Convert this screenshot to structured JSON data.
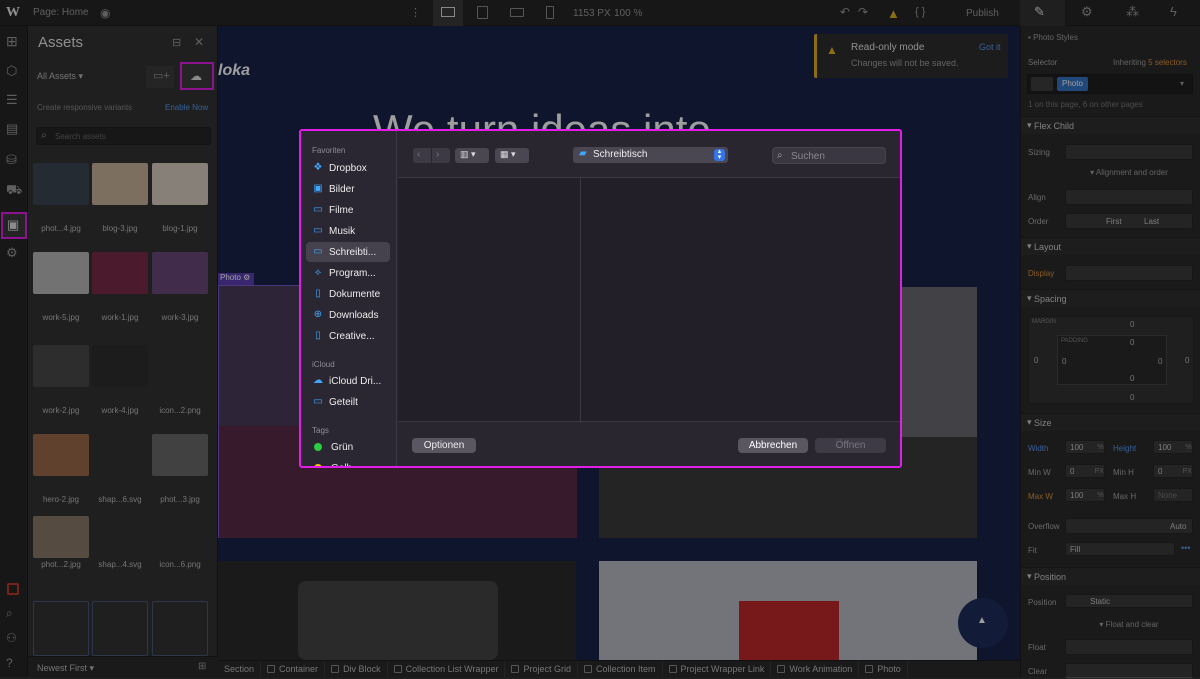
{
  "topbar": {
    "logo": "W",
    "page_label": "Page: Home",
    "width_readout": "1153 PX",
    "zoom_readout": "100 %",
    "publish_label": "Publish"
  },
  "banner": {
    "title": "Read-only mode",
    "subtitle": "Changes will not be saved.",
    "action": "Got it"
  },
  "assets": {
    "title": "Assets",
    "filter": "All Assets",
    "responsive_text": "Create responsive variants",
    "enable_now": "Enable Now",
    "search_placeholder": "Search assets",
    "sort": "Newest First",
    "items": [
      {
        "label": "phot...4.jpg",
        "color": "#3a4652"
      },
      {
        "label": "blog-3.jpg",
        "color": "#c9b39a"
      },
      {
        "label": "blog-1.jpg",
        "color": "#d8cfc2"
      },
      {
        "label": "work-5.jpg",
        "color": "#b8b8b8"
      },
      {
        "label": "work-1.jpg",
        "color": "#7a2a4a"
      },
      {
        "label": "work-3.jpg",
        "color": "#6a4a7a"
      },
      {
        "label": "work-2.jpg",
        "color": "#4a4a4a"
      },
      {
        "label": "work-4.jpg",
        "color": "#2e2e2e"
      },
      {
        "label": "icon...2.png",
        "color": "#333333"
      },
      {
        "label": "hero-2.jpg",
        "color": "#9a6a4a"
      },
      {
        "label": "shap...6.svg",
        "color": "#333333"
      },
      {
        "label": "phot...3.jpg",
        "color": "#6a6a6a"
      },
      {
        "label": "phot...2.jpg",
        "color": "#8a7a6a"
      },
      {
        "label": "shap...4.svg",
        "color": "#333333"
      },
      {
        "label": "icon...6.png",
        "color": "#333333"
      }
    ]
  },
  "canvas": {
    "logo_text": "loka",
    "hero_text": "We turn ideas into",
    "photo_tag": "Photo"
  },
  "dialog": {
    "location": "Schreibtisch",
    "search_placeholder": "Suchen",
    "favorites_header": "Favoriten",
    "favorites": [
      {
        "label": "Dropbox",
        "icon": "dropbox-icon"
      },
      {
        "label": "Bilder",
        "icon": "pictures-icon"
      },
      {
        "label": "Filme",
        "icon": "folder-icon"
      },
      {
        "label": "Musik",
        "icon": "folder-icon"
      },
      {
        "label": "Schreibti...",
        "icon": "folder-icon"
      },
      {
        "label": "Program...",
        "icon": "applications-icon"
      },
      {
        "label": "Dokumente",
        "icon": "document-icon"
      },
      {
        "label": "Downloads",
        "icon": "download-icon"
      },
      {
        "label": "Creative...",
        "icon": "document-icon"
      }
    ],
    "icloud_header": "iCloud",
    "icloud": [
      {
        "label": "iCloud Dri...",
        "icon": "cloud-icon"
      },
      {
        "label": "Geteilt",
        "icon": "shared-folder-icon"
      }
    ],
    "tags_header": "Tags",
    "tags": [
      {
        "label": "Grün",
        "color": "#2ecc40"
      },
      {
        "label": "Gelb",
        "color": "#f5c400"
      }
    ],
    "options_label": "Optionen",
    "cancel_label": "Abbrechen",
    "open_label": "Öffnen"
  },
  "right": {
    "style_label": "Photo Styles",
    "selector_label": "Selector",
    "inheriting": "Inheriting",
    "inheriting_count": "5 selectors",
    "selector_tag": "Photo",
    "page_count": "1 on this page, 6 on other pages",
    "flex_child": "Flex Child",
    "sizing": "Sizing",
    "alignment_order": "Alignment and order",
    "align": "Align",
    "order": "Order",
    "order_first": "First",
    "order_last": "Last",
    "layout": "Layout",
    "display": "Display",
    "spacing": "Spacing",
    "margin": "MARGIN",
    "padding": "PADDING",
    "zero": "0",
    "size": "Size",
    "width": "Width",
    "width_val": "100",
    "height": "Height",
    "height_val": "100",
    "pct": "%",
    "min_w": "Min W",
    "min_h": "Min H",
    "max_w": "Max W",
    "max_w_val": "100",
    "max_h": "Max H",
    "none": "None",
    "px": "PX",
    "dash": "0",
    "overflow": "Overflow",
    "auto": "Auto",
    "fit": "Fit",
    "fit_val": "Fill",
    "position": "Position",
    "position_label": "Position",
    "position_val": "Static",
    "float_clear": "Float and clear",
    "float": "Float",
    "clear": "Clear"
  },
  "breadcrumbs": [
    "Section",
    "Container",
    "Div Block",
    "Collection List Wrapper",
    "Project Grid",
    "Collection Item",
    "Project Wrapper Link",
    "Work Animation",
    "Photo"
  ]
}
